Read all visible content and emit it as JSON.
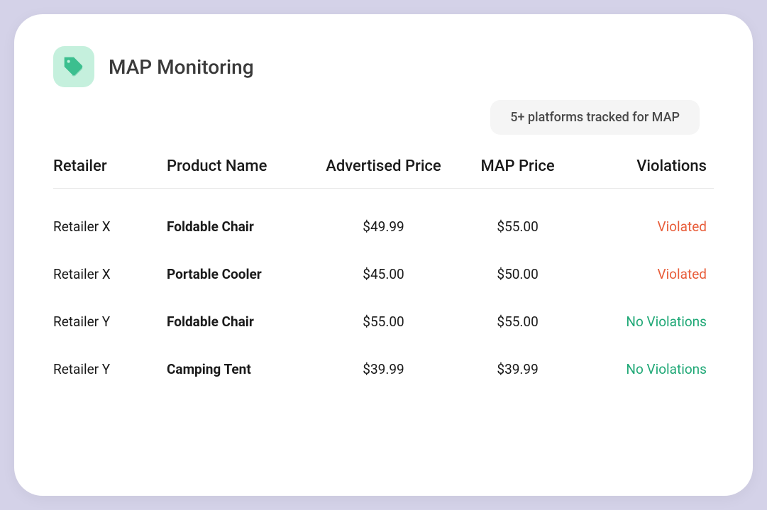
{
  "header": {
    "title": "MAP Monitoring",
    "badge": "5+ platforms tracked for MAP"
  },
  "columns": {
    "retailer": "Retailer",
    "product": "Product Name",
    "price": "Advertised Price",
    "map": "MAP Price",
    "violations": "Violations"
  },
  "status": {
    "violated": "Violated",
    "ok": "No Violations"
  },
  "rows": [
    {
      "retailer": "Retailer X",
      "product": "Foldable Chair",
      "price": "$49.99",
      "map": "$55.00",
      "violation": "violated"
    },
    {
      "retailer": "Retailer X",
      "product": "Portable Cooler",
      "price": "$45.00",
      "map": "$50.00",
      "violation": "violated"
    },
    {
      "retailer": "Retailer Y",
      "product": "Foldable Chair",
      "price": "$55.00",
      "map": "$55.00",
      "violation": "ok"
    },
    {
      "retailer": "Retailer Y",
      "product": "Camping Tent",
      "price": "$39.99",
      "map": "$39.99",
      "violation": "ok"
    }
  ]
}
